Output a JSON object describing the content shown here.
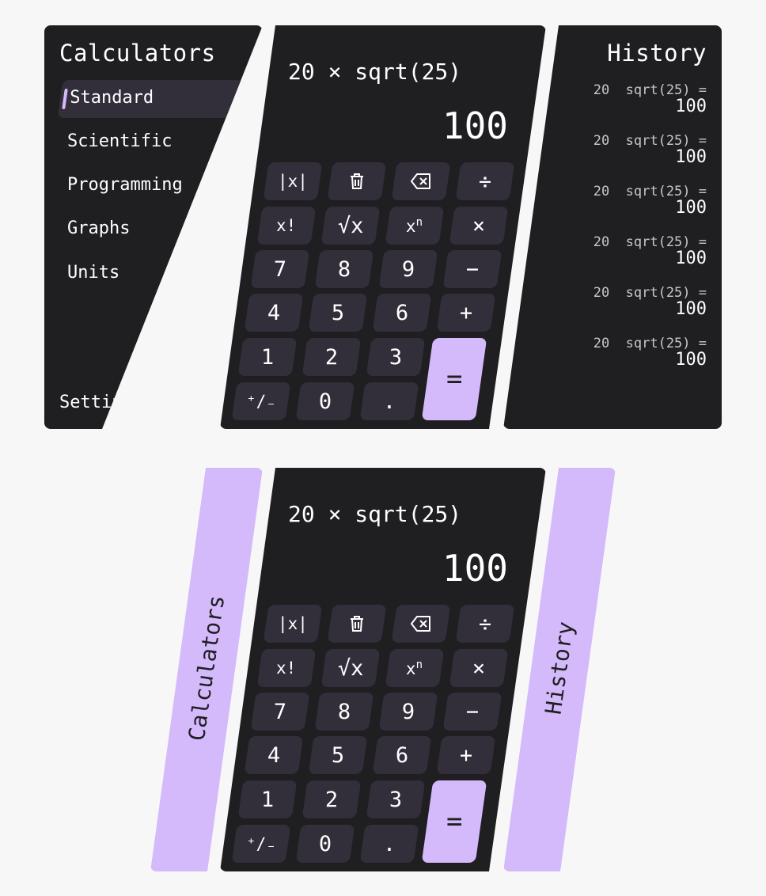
{
  "nav": {
    "title": "Calculators",
    "items": [
      {
        "label": "Standard",
        "active": true
      },
      {
        "label": "Scientific"
      },
      {
        "label": "Programming"
      },
      {
        "label": "Graphs"
      },
      {
        "label": "Units"
      }
    ],
    "settings": "Settings"
  },
  "calculator": {
    "expression": "20 × sqrt(25)",
    "result": "100",
    "keys": {
      "abs": "|x|",
      "clear": "trash-icon",
      "backspace": "backspace-icon",
      "divide": "÷",
      "factorial": "x!",
      "sqrt": "√x",
      "power_base": "x",
      "power_exp": "n",
      "multiply": "×",
      "seven": "7",
      "eight": "8",
      "nine": "9",
      "minus": "−",
      "four": "4",
      "five": "5",
      "six": "6",
      "plus": "+",
      "one": "1",
      "two": "2",
      "three": "3",
      "sign": "⁺∕₋",
      "zero": "0",
      "dot": ".",
      "equals": "="
    }
  },
  "history": {
    "title": "History",
    "entries": [
      {
        "expression": "20  sqrt(25) =",
        "value": "100"
      },
      {
        "expression": "20  sqrt(25) =",
        "value": "100"
      },
      {
        "expression": "20  sqrt(25) =",
        "value": "100"
      },
      {
        "expression": "20  sqrt(25) =",
        "value": "100"
      },
      {
        "expression": "20  sqrt(25) =",
        "value": "100"
      },
      {
        "expression": "20  sqrt(25) =",
        "value": "100"
      }
    ]
  },
  "collapsed": {
    "calculators_label": "Calculators",
    "history_label": "History"
  },
  "colors": {
    "panel": "#1f1e21",
    "key": "#322e3a",
    "accent": "#d4b9fb",
    "background": "#f7f7f8"
  }
}
